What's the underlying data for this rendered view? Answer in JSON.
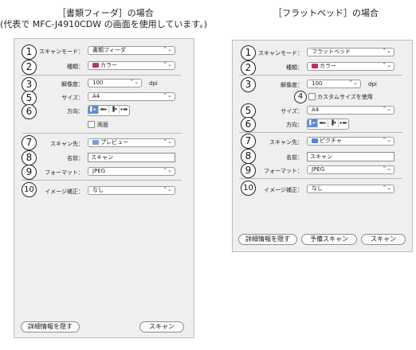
{
  "headers": {
    "left_line1": "［書類フィーダ］の場合",
    "left_line2": "(代表で MFC-J4910CDW の画面を使用しています。)",
    "right_line1": "［フラットベッド］の場合"
  },
  "left": {
    "numbers": [
      "1",
      "2",
      "3",
      "5",
      "6",
      "7",
      "8",
      "9",
      "10"
    ],
    "labels": {
      "scan_mode": "スキャンモード：",
      "kind": "種類：",
      "resolution": "解像度：",
      "size": "サイズ：",
      "orientation": "方向：",
      "scan_to": "スキャン先：",
      "name": "名前：",
      "format": "フォーマット：",
      "image_correction": "イメージ補正："
    },
    "values": {
      "scan_mode": "書類フィーダ",
      "kind": "カラー",
      "resolution": "100",
      "resolution_unit": "dpi",
      "size": "A4",
      "duplex": "両面",
      "scan_to": "プレビュー",
      "name": "スキャン",
      "format": "JPEG",
      "image_correction": "なし"
    },
    "buttons": {
      "details": "詳細情報を隠す",
      "scan": "スキャン"
    }
  },
  "right": {
    "numbers": [
      "1",
      "2",
      "3",
      "4",
      "5",
      "6",
      "7",
      "8",
      "9",
      "10"
    ],
    "labels": {
      "scan_mode": "スキャンモード：",
      "kind": "種類：",
      "resolution": "解像度：",
      "size": "サイズ：",
      "orientation": "方向：",
      "scan_to": "スキャン先：",
      "name": "名前：",
      "format": "フォーマット：",
      "image_correction": "イメージ補正："
    },
    "values": {
      "scan_mode": "フラットベッド",
      "kind": "カラー",
      "resolution": "100",
      "resolution_unit": "dpi",
      "custom_size": "カスタムサイズを使用",
      "size": "A4",
      "scan_to": "ピクチャ",
      "name": "スキャン",
      "format": "JPEG",
      "image_correction": "なし"
    },
    "buttons": {
      "details": "詳細情報を隠す",
      "prescan": "予備スキャン",
      "scan": "スキャン"
    }
  },
  "arrow_glyph": "⌃⌄",
  "colors": {
    "selected_segment": "#5b8bd6",
    "kind_icon": "#c0306a",
    "folder_icon": "#5a86c8"
  }
}
